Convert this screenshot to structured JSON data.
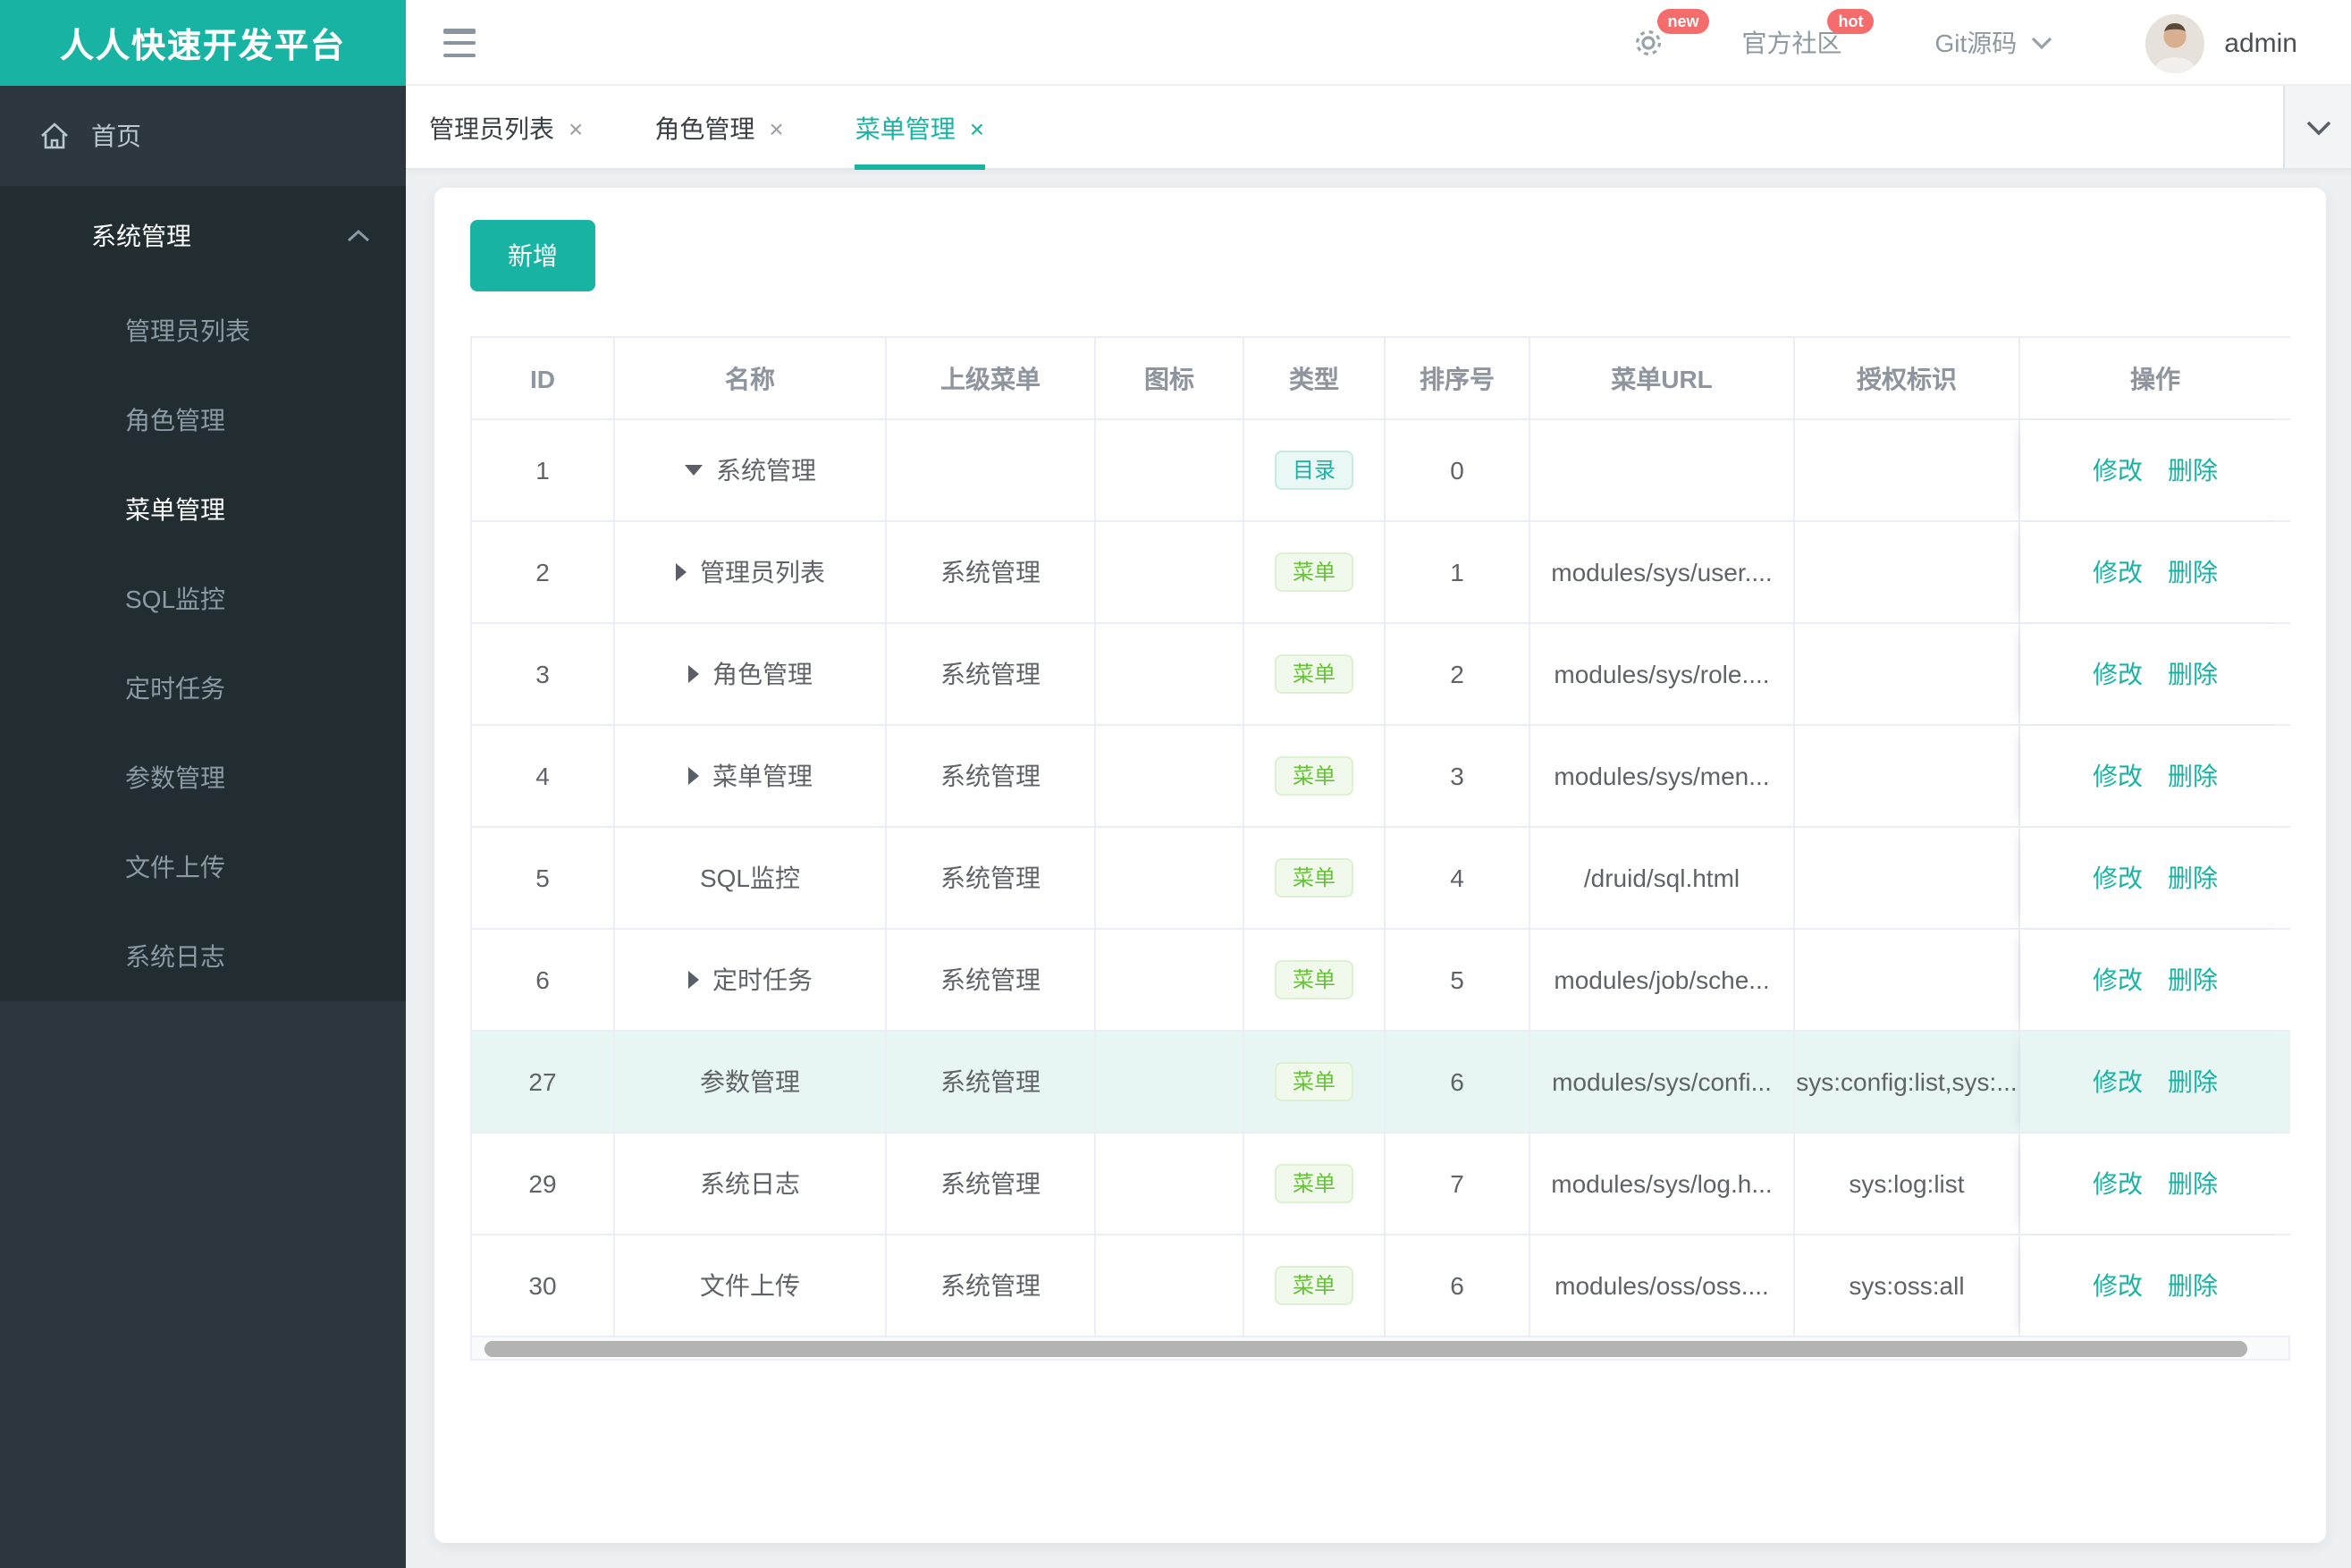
{
  "brand": {
    "title": "人人快速开发平台",
    "accent_color": "#18b3a3",
    "badge_color": "#f56c6c"
  },
  "header": {
    "badge_new": "new",
    "community_label": "官方社区",
    "badge_hot": "hot",
    "git_label": "Git源码",
    "user_name": "admin"
  },
  "sidebar": {
    "home_label": "首页",
    "group_label": "系统管理",
    "items": [
      {
        "label": "管理员列表",
        "active": false
      },
      {
        "label": "角色管理",
        "active": false
      },
      {
        "label": "菜单管理",
        "active": true
      },
      {
        "label": "SQL监控",
        "active": false
      },
      {
        "label": "定时任务",
        "active": false
      },
      {
        "label": "参数管理",
        "active": false
      },
      {
        "label": "文件上传",
        "active": false
      },
      {
        "label": "系统日志",
        "active": false
      }
    ]
  },
  "tabs": [
    {
      "label": "管理员列表",
      "active": false
    },
    {
      "label": "角色管理",
      "active": false
    },
    {
      "label": "菜单管理",
      "active": true
    }
  ],
  "toolbar": {
    "add_label": "新增"
  },
  "table": {
    "columns": [
      "ID",
      "名称",
      "上级菜单",
      "图标",
      "类型",
      "排序号",
      "菜单URL",
      "授权标识",
      "操作"
    ],
    "actions": {
      "edit": "修改",
      "delete": "删除"
    },
    "type_colors": {
      "目录": "#18b3a3",
      "菜单": "#67c23a"
    },
    "rows": [
      {
        "id": "1",
        "caret": "down",
        "name": "系统管理",
        "parent": "",
        "icon": "",
        "type": "目录",
        "order": "0",
        "url": "",
        "perms": "",
        "highlight": false
      },
      {
        "id": "2",
        "caret": "right",
        "name": "管理员列表",
        "parent": "系统管理",
        "icon": "",
        "type": "菜单",
        "order": "1",
        "url": "modules/sys/user....",
        "perms": "",
        "highlight": false
      },
      {
        "id": "3",
        "caret": "right",
        "name": "角色管理",
        "parent": "系统管理",
        "icon": "",
        "type": "菜单",
        "order": "2",
        "url": "modules/sys/role....",
        "perms": "",
        "highlight": false
      },
      {
        "id": "4",
        "caret": "right",
        "name": "菜单管理",
        "parent": "系统管理",
        "icon": "",
        "type": "菜单",
        "order": "3",
        "url": "modules/sys/men...",
        "perms": "",
        "highlight": false
      },
      {
        "id": "5",
        "caret": "none",
        "name": "SQL监控",
        "parent": "系统管理",
        "icon": "",
        "type": "菜单",
        "order": "4",
        "url": "/druid/sql.html",
        "perms": "",
        "highlight": false
      },
      {
        "id": "6",
        "caret": "right",
        "name": "定时任务",
        "parent": "系统管理",
        "icon": "",
        "type": "菜单",
        "order": "5",
        "url": "modules/job/sche...",
        "perms": "",
        "highlight": false
      },
      {
        "id": "27",
        "caret": "none",
        "name": "参数管理",
        "parent": "系统管理",
        "icon": "",
        "type": "菜单",
        "order": "6",
        "url": "modules/sys/confi...",
        "perms": "sys:config:list,sys:...",
        "highlight": true
      },
      {
        "id": "29",
        "caret": "none",
        "name": "系统日志",
        "parent": "系统管理",
        "icon": "",
        "type": "菜单",
        "order": "7",
        "url": "modules/sys/log.h...",
        "perms": "sys:log:list",
        "highlight": false
      },
      {
        "id": "30",
        "caret": "none",
        "name": "文件上传",
        "parent": "系统管理",
        "icon": "",
        "type": "菜单",
        "order": "6",
        "url": "modules/oss/oss....",
        "perms": "sys:oss:all",
        "highlight": false
      }
    ]
  }
}
